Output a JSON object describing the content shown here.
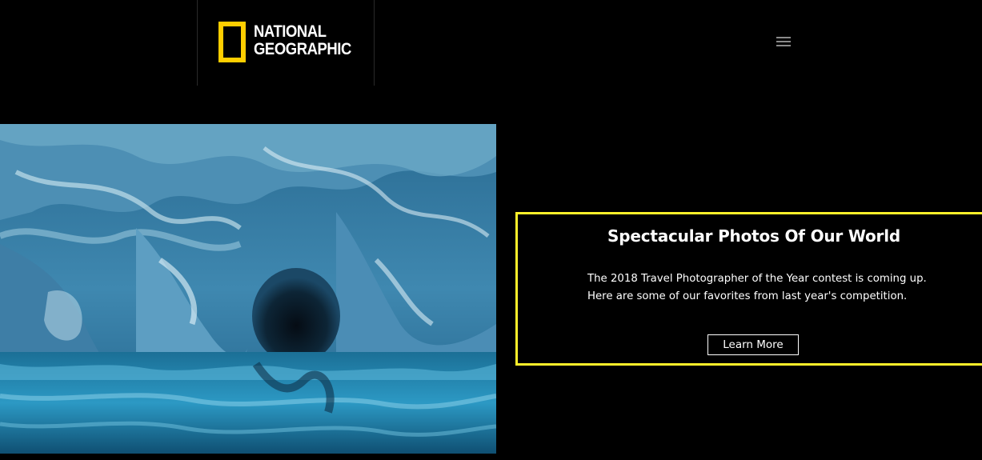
{
  "header": {
    "logo": {
      "line1": "NATIONAL",
      "line2": "GEOGRAPHIC",
      "frame_color": "#ffce00"
    },
    "menu_icon": "hamburger-icon"
  },
  "hero": {
    "image_subject": "marble-caves-photo"
  },
  "feature": {
    "title": "Spectacular Photos Of Our World",
    "description_line1": "The 2018 Travel Photographer of the Year contest is coming up.",
    "description_line2": "Here are some of our favorites from last year's competition.",
    "button_label": "Learn More",
    "border_color": "#fff02a"
  },
  "colors": {
    "background": "#000000",
    "accent": "#fff02a"
  }
}
